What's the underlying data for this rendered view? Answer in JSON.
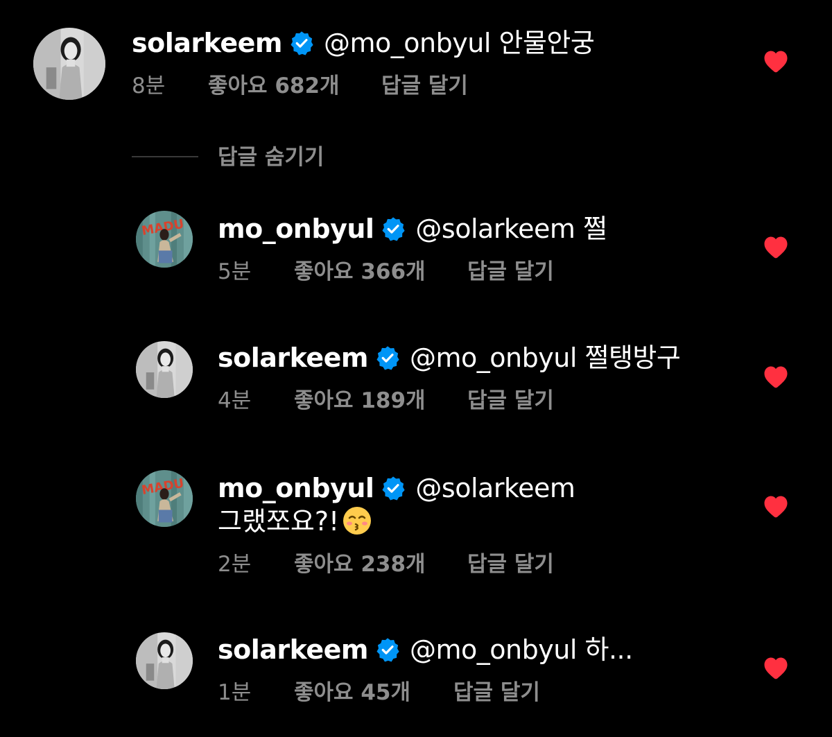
{
  "colors": {
    "background": "#000000",
    "text": "#ffffff",
    "meta": "#8e8e8e",
    "verified": "#0095f6",
    "heart": "#ff3040"
  },
  "comments": [
    {
      "username": "solarkeem",
      "verified_icon": "verified-badge-icon",
      "mention": "@mo_onbyul",
      "text": "안물안궁",
      "time": "8분",
      "likes": "좋아요 682개",
      "reply": "답글 달기",
      "liked": true
    },
    {
      "username": "mo_onbyul",
      "verified_icon": "verified-badge-icon",
      "mention": "@solarkeem",
      "text": "쩔",
      "time": "5분",
      "likes": "좋아요 366개",
      "reply": "답글 달기",
      "liked": true
    },
    {
      "username": "solarkeem",
      "verified_icon": "verified-badge-icon",
      "mention": "@mo_onbyul",
      "text": "쩔탱방구",
      "time": "4분",
      "likes": "좋아요 189개",
      "reply": "답글 달기",
      "liked": true
    },
    {
      "username": "mo_onbyul",
      "verified_icon": "verified-badge-icon",
      "mention": "@solarkeem",
      "text": "그랬쪼요?!",
      "emoji": "kissing-face-with-smiling-eyes",
      "time": "2분",
      "likes": "좋아요 238개",
      "reply": "답글 달기",
      "liked": true
    },
    {
      "username": "solarkeem",
      "verified_icon": "verified-badge-icon",
      "mention": "@mo_onbyul",
      "text": "하...",
      "time": "1분",
      "likes": "좋아요 45개",
      "reply": "답글 달기",
      "liked": true
    }
  ],
  "hide_replies_label": "답글 숨기기"
}
